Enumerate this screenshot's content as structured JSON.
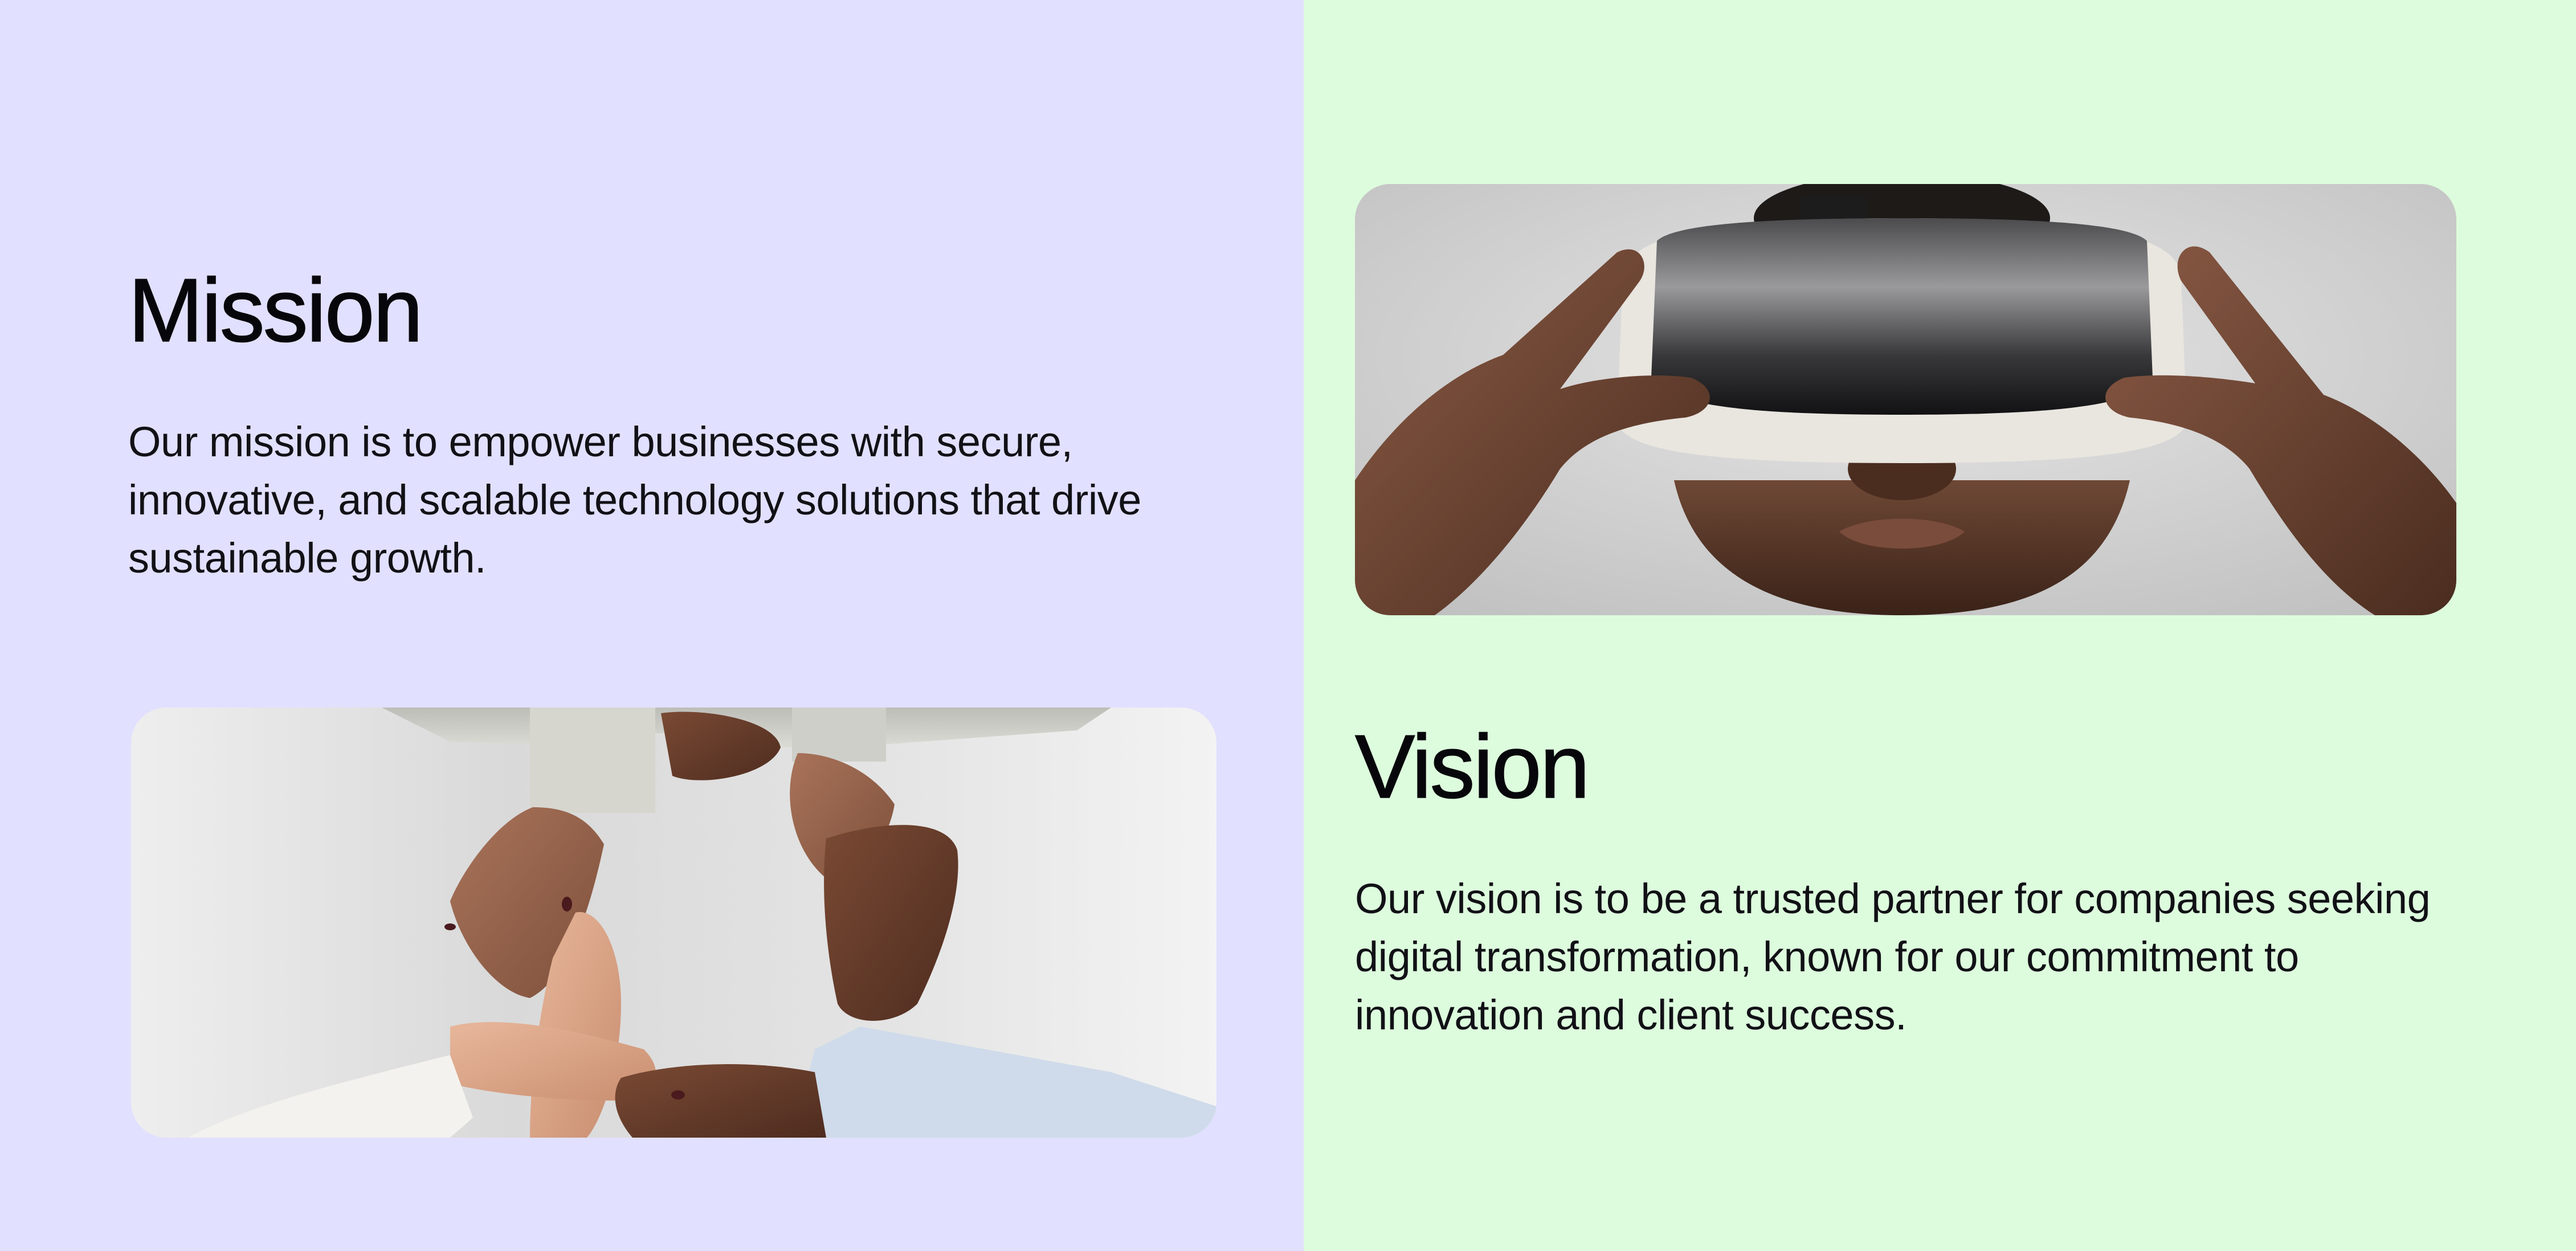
{
  "mission": {
    "title": "Mission",
    "text": "Our mission is to empower businesses with secure, innovative, and scalable technology solutions that drive sustainable growth.",
    "image": "photo of interlocked hands of several people"
  },
  "vision": {
    "title": "Vision",
    "text": "Our vision is to be a trusted partner for companies seeking digital transformation, known for our commitment to innovation and client success.",
    "image": "photo of a man wearing a virtual reality headset"
  },
  "colors": {
    "mission_background": "#e1e0fe",
    "vision_background": "#ddfcdd",
    "text": "#0b0b0f"
  }
}
